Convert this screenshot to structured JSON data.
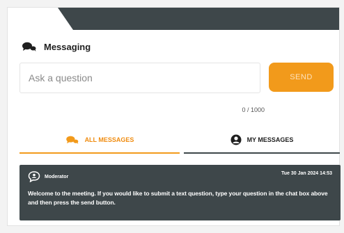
{
  "messaging": {
    "title": "Messaging",
    "icon": "chat-bubbles-icon"
  },
  "question_input": {
    "placeholder": "Ask a question",
    "value": ""
  },
  "send_button": {
    "label": "SEND",
    "color": "#f29a1b"
  },
  "char_counter": "0 / 1000",
  "tabs": [
    {
      "label": "ALL MESSAGES",
      "icon": "chat-bubbles-icon",
      "active": true,
      "color": "#f08c10"
    },
    {
      "label": "MY MESSAGES",
      "icon": "user-icon",
      "active": false
    }
  ],
  "messages": [
    {
      "author": "Moderator",
      "timestamp": "Tue 30 Jan 2024 14:53",
      "text": "Welcome to the meeting. If you would like to submit a text question, type your question in the chat box above and then press the send button.",
      "icon": "moderator-icon"
    }
  ],
  "colors": {
    "header_band": "#3e474a",
    "message_bg": "#3e474a",
    "accent": "#f29a1b"
  }
}
